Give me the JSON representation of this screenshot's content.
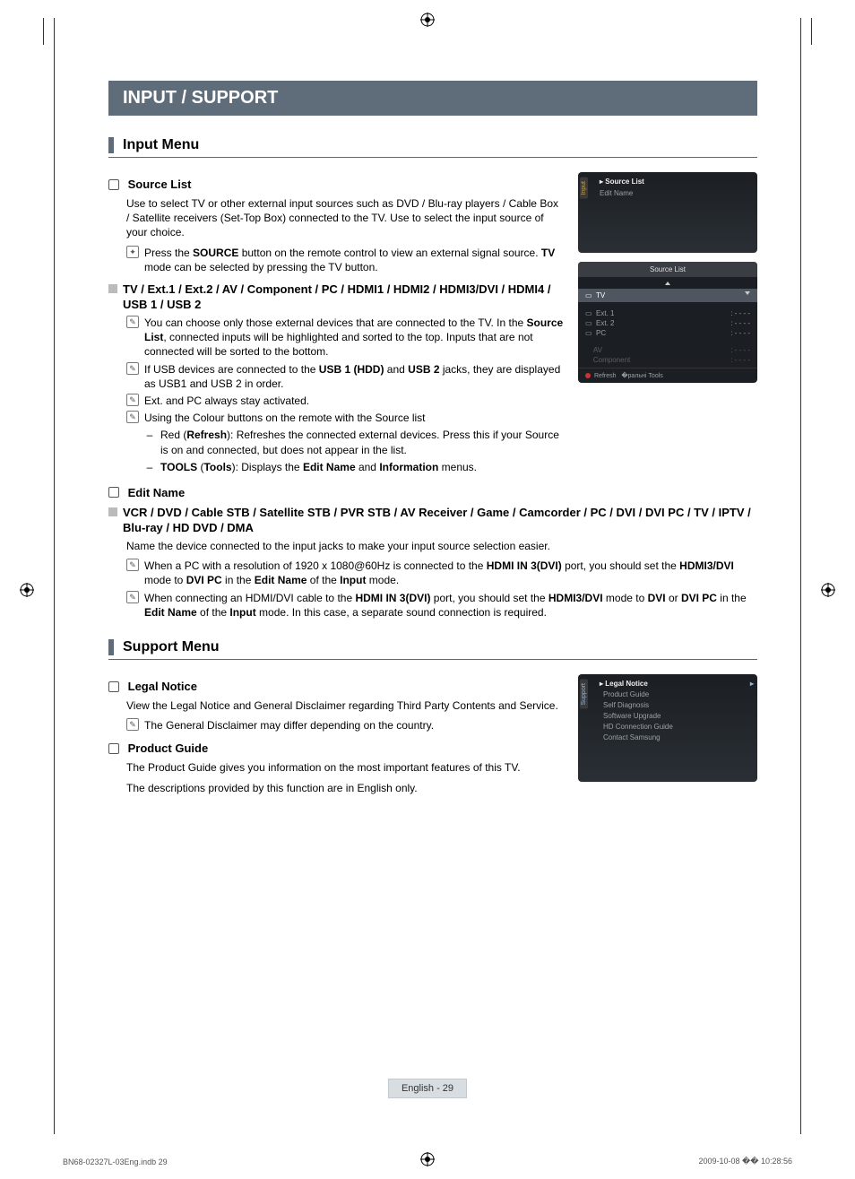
{
  "chapter": "INPUT / SUPPORT",
  "sections": {
    "input_menu": {
      "title": "Input Menu",
      "source_list": {
        "heading": "Source List",
        "desc": "Use to select TV or other external input sources such as DVD / Blu-ray players / Cable Box / Satellite receivers (Set-Top Box) connected to the TV. Use to select the input source of your choice.",
        "note1_pre": "Press the ",
        "note1_b1": "SOURCE",
        "note1_mid": " button on the remote control to view an external signal source. ",
        "note1_b2": "TV",
        "note1_post": " mode can be selected by pressing the TV button."
      },
      "inputs_heading": "TV / Ext.1 / Ext.2 / AV / Component / PC / HDMI1 / HDMI2 / HDMI3/DVI / HDMI4 / USB 1 / USB 2",
      "inputs_notes": {
        "n1_a": "You can choose only those external devices that are connected to the TV. In the ",
        "n1_b": "Source List",
        "n1_c": ", connected inputs will be highlighted and sorted to the top. Inputs that are not connected will be sorted to the bottom.",
        "n2_a": "If USB devices are connected to the ",
        "n2_b": "USB 1 (HDD)",
        "n2_c": " and ",
        "n2_d": "USB 2",
        "n2_e": " jacks, they are displayed as USB1 and USB 2 in order.",
        "n3": "Ext. and PC always stay activated.",
        "n4": "Using the Colour buttons on the remote with the Source list",
        "n4a_pre": "Red (",
        "n4a_b": "Refresh",
        "n4a_post": "): Refreshes the connected external devices. Press this if your Source is on and connected, but does not appear in the list.",
        "n4b_b1": "TOOLS",
        "n4b_mid": " (",
        "n4b_b2": "Tools",
        "n4b_post": "): Displays the ",
        "n4b_b3": "Edit Name",
        "n4b_and": " and ",
        "n4b_b4": "Information",
        "n4b_end": " menus."
      },
      "edit_name": {
        "heading": "Edit Name",
        "devices": "VCR / DVD / Cable STB / Satellite STB / PVR STB / AV Receiver / Game / Camcorder / PC / DVI / DVI PC / TV / IPTV / Blu-ray / HD DVD / DMA",
        "desc": "Name the device connected to the input jacks to make your input source selection easier.",
        "n1_a": "When a PC with a resolution of 1920 x 1080@60Hz is connected to the ",
        "n1_b": "HDMI IN 3(DVI)",
        "n1_c": " port, you should set the ",
        "n1_d": "HDMI3/DVI",
        "n1_e": " mode to ",
        "n1_f": "DVI PC",
        "n1_g": " in the ",
        "n1_h": "Edit Name",
        "n1_i": " of the ",
        "n1_j": "Input",
        "n1_k": " mode.",
        "n2_a": "When connecting an HDMI/DVI cable to the ",
        "n2_b": "HDMI IN 3(DVI)",
        "n2_c": " port, you should set the ",
        "n2_d": "HDMI3/DVI",
        "n2_e": " mode to ",
        "n2_f": "DVI",
        "n2_g": " or ",
        "n2_h": "DVI PC",
        "n2_i": " in the ",
        "n2_j": "Edit Name",
        "n2_k": " of the ",
        "n2_l": "Input",
        "n2_m": " mode. In this case, a separate sound connection is required."
      }
    },
    "support_menu": {
      "title": "Support Menu",
      "legal": {
        "heading": "Legal Notice",
        "desc": "View the Legal Notice and General Disclaimer regarding Third Party Contents and Service.",
        "note": "The General Disclaimer may differ depending on the country."
      },
      "product_guide": {
        "heading": "Product Guide",
        "l1": "The Product Guide gives you information on the most important features of this TV.",
        "l2": "The descriptions provided by this function are in English only."
      }
    }
  },
  "osd": {
    "input_panel": {
      "tab": "Input",
      "title": "Source List",
      "row2": "Edit Name"
    },
    "source_list_panel": {
      "header": "Source List",
      "selected": "TV",
      "rows": [
        "Ext. 1",
        "Ext. 2",
        "PC"
      ],
      "dim_rows": [
        "AV",
        "Component"
      ],
      "dashes": ": - - - -",
      "foot_refresh": "Refresh",
      "foot_tools": "Tools"
    },
    "support_panel": {
      "tab": "Support",
      "title": "Legal Notice",
      "rows": [
        "Product Guide",
        "Self Diagnosis",
        "Software Upgrade",
        "HD Connection Guide",
        "Contact Samsung"
      ]
    }
  },
  "footer": {
    "page": "English - 29",
    "left": "BN68-02327L-03Eng.indb   29",
    "right": "2009-10-08   �� 10:28:56"
  }
}
